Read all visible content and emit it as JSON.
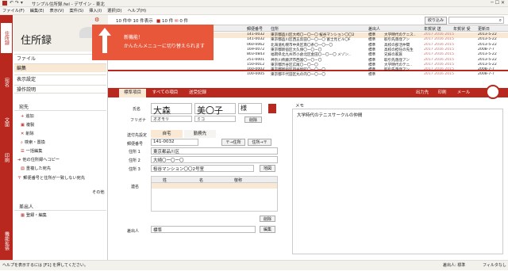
{
  "window": {
    "title": "サンプル住所録.fwl - デザイン - 東北"
  },
  "menu": [
    "ファイル(F)",
    "編集(E)",
    "表示(V)",
    "案件(S)",
    "挿入(I)",
    "選択(D)",
    "ヘルプ(H)"
  ],
  "left_tabs": [
    "住所録",
    "宛名",
    "文面",
    "印刷",
    "機能拡張"
  ],
  "sidebar": {
    "title": "住所録",
    "menu": [
      "ファイル",
      "編集",
      "表示設定",
      "操作説明"
    ],
    "section_address": "宛先",
    "address_items": [
      "追加",
      "複製",
      "削除",
      "検索・置換",
      "一括編集",
      "他の住所録へコピー",
      "重複した宛先",
      "郵便番号と住所が一致しない宛先"
    ],
    "more": "その他",
    "section_sender": "差出人",
    "sender_items": [
      "登録・編集"
    ]
  },
  "toolbar": {
    "count": "10 件中 10 件表示",
    "flags1": "10 件",
    "flags2": "0 件",
    "filter": "絞り込み"
  },
  "popup": {
    "line1": "新機能！",
    "line2": "かんたんメニューに切り替えられます"
  },
  "table": {
    "headers": [
      "郵便番号",
      "住所",
      "差出人",
      "年賀状 送",
      "年賀状 受",
      "更新日"
    ],
    "rows": [
      [
        "141-0032",
        "東京都品川区大崎〇ー〇ー〇 桜谷マンション〇〇2",
        "標準",
        "大学時代のテニス..",
        "2017 2016 2015",
        "2013-5-22"
      ],
      [
        "141-0032",
        "東京都品川区西五反田〇ー〇ー〇 富士見ビル〇F",
        "標準",
        "取引先落窪アン",
        "2017 2016 2015",
        "2013-5-22"
      ],
      [
        "060-0062",
        "北海道札幌市中央区南〇条〇ー〇ー〇",
        "標準",
        "高校の部活仲間",
        "2017 2016 2015",
        "2013-5-22"
      ],
      [
        "169-0072",
        "東京都新宿区大久保〇ー〇ー〇",
        "標準",
        "高校の担任の先生",
        "2017 2016 2015",
        "2008-7-7"
      ],
      [
        "803-0843",
        "福岡県北九州市小倉北区金田〇ー〇ー〇 メゾン..",
        "標準",
        "兄嫁の家族",
        "2017 2016 2015",
        "2013-5-22"
      ],
      [
        "251-0001",
        "神奈川県藤沢市西富〇ー〇ー〇",
        "標準",
        "取引先落窪アン",
        "2017 2016 2015",
        "2013-5-22"
      ],
      [
        "150-0012",
        "東京都渋谷区広尾〇ー〇ー〇",
        "標準",
        "大学時代のテニ..",
        "2017 2016 2015",
        "2013-5-22"
      ],
      [
        "160-0002",
        "東京都新宿区四谷坂町〇ー〇ー〇",
        "標準",
        "取引先落窪アン",
        "2017 2016 2015",
        "2008-7-7"
      ],
      [
        "100-0005",
        "東京都千代田区丸の内〇ー〇ー〇",
        "標準",
        "",
        "2017 2016 2015",
        "2008-7-7"
      ]
    ]
  },
  "detail": {
    "tabs": [
      "標準項目",
      "すべての項目",
      "送受記録"
    ],
    "actions": [
      "出力先",
      "印刷",
      "メール"
    ],
    "name_label": "氏名",
    "surname": "大森",
    "given": "美〇子",
    "honorific": "様",
    "furigana_label": "フリガナ",
    "furigana1": "オオモリ",
    "furigana2": "ミコ",
    "delete": "削除",
    "send_label": "送付先設定",
    "home": "自宅",
    "work": "勤務先",
    "zip_label": "郵便番号",
    "zip": "141-0032",
    "to_addr": "〒→住所",
    "from_addr": "住所→〒",
    "addr1_label": "住所 1",
    "addr1": "東京都品川区",
    "addr2_label": "住所 2",
    "addr2": "大崎〇ー〇ー〇",
    "addr3_label": "住所 3",
    "addr3": "桜谷マンション〇〇2号室",
    "map": "地図",
    "joint_label": "連名",
    "joint_cols": [
      "姓",
      "名",
      "敬称"
    ],
    "joint_delete": "削除",
    "sender_label": "差出人",
    "sender_value": "標準",
    "edit": "編集",
    "memo_label": "メモ",
    "memo": "大学時代のテニスサークルの仲間"
  },
  "status": {
    "left": "ヘルプを表示するには [F1] を押してください。",
    "mid": "差出人: 標準",
    "right": "フィルタなし"
  },
  "colors": {
    "accent": "#b8281f",
    "popup": "#e8573a"
  }
}
